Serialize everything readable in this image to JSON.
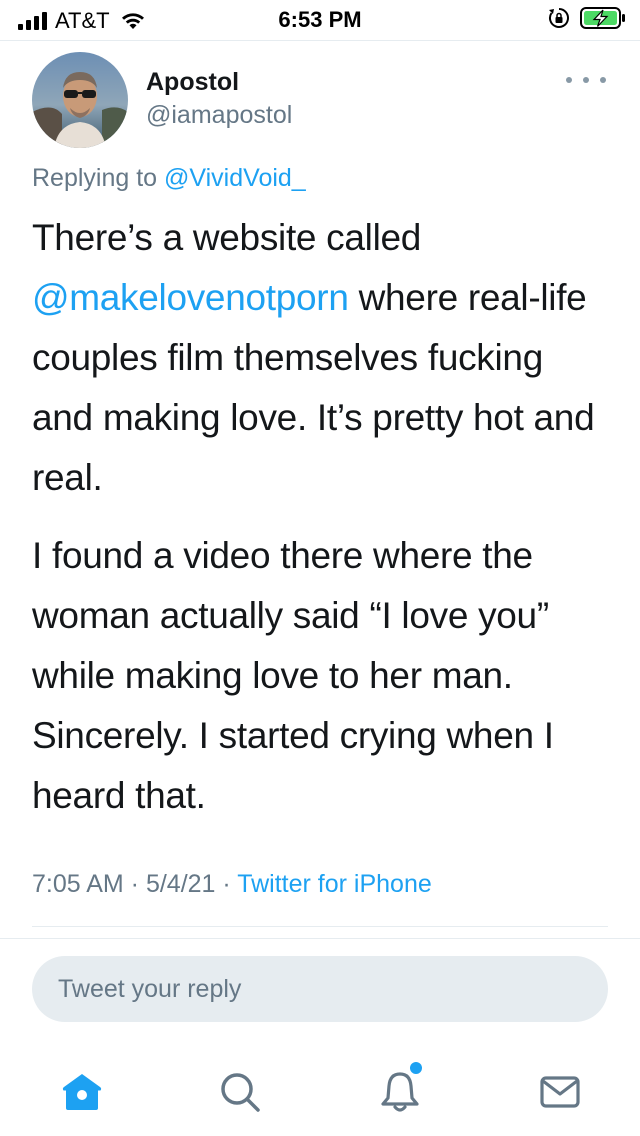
{
  "status_bar": {
    "carrier": "AT&T",
    "time": "6:53 PM"
  },
  "tweet": {
    "author_name": "Apostol",
    "author_handle": "@iamapostol",
    "replying_prefix": "Replying to",
    "replying_to": "@VividVoid_",
    "paragraph1_before": "There’s a website called ",
    "paragraph1_mention": "@makelovenotporn",
    "paragraph1_after": " where real-life couples film themselves fucking and making love. It’s pretty hot and real.",
    "paragraph2": "I found a video there where the woman actually said “I love you” while making love to her man. Sincerely. I started crying when I heard that.",
    "time": "7:05 AM",
    "separator": " · ",
    "date": "5/4/21",
    "source": "Twitter for iPhone"
  },
  "reply": {
    "placeholder": "Tweet your reply"
  },
  "colors": {
    "accent": "#1da1f2",
    "secondary_text": "#657786",
    "divider": "#e6ecf0"
  },
  "icons": {
    "tabs": [
      "home-icon",
      "search-icon",
      "notifications-icon",
      "messages-icon"
    ],
    "notification_badge": true
  }
}
